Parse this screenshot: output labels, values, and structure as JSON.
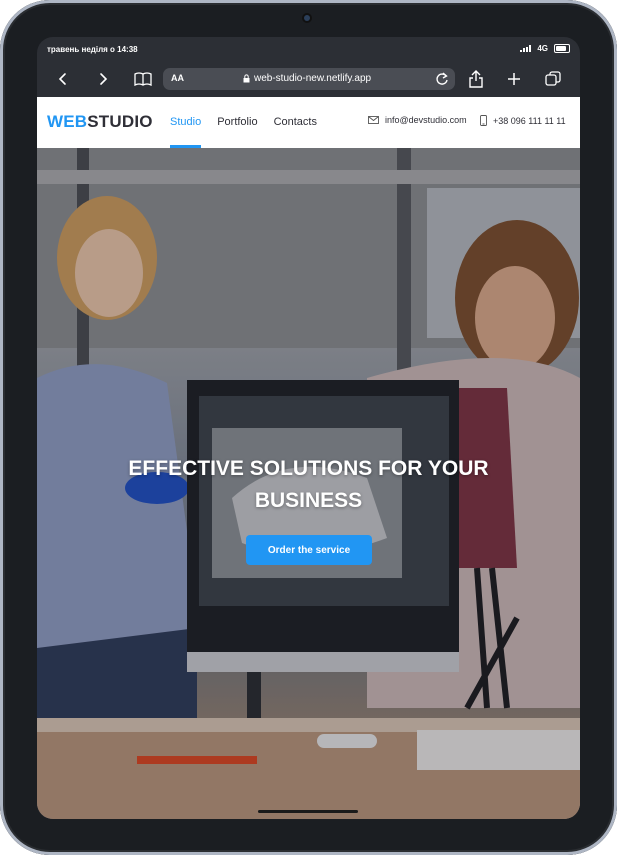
{
  "status_bar": {
    "time": "травень неділя о 14:38",
    "network": "4G"
  },
  "browser": {
    "text_size_label": "AA",
    "url": "web-studio-new.netlify.app",
    "icons": [
      "back-icon",
      "forward-icon",
      "bookmarks-icon",
      "lock-icon",
      "reload-icon",
      "share-icon",
      "new-tab-icon",
      "tabs-icon"
    ]
  },
  "site_header": {
    "logo_part1": "WEB",
    "logo_part2": "STUDIO",
    "nav": [
      {
        "label": "Studio",
        "active": true
      },
      {
        "label": "Portfolio",
        "active": false
      },
      {
        "label": "Contacts",
        "active": false
      }
    ],
    "email": "info@devstudio.com",
    "phone": "+38 096 111 11 11"
  },
  "hero": {
    "title": "EFFECTIVE SOLUTIONS FOR YOUR BUSINESS",
    "button": "Order the service"
  },
  "colors": {
    "accent": "#2196f3",
    "dark_text": "#2f2f37",
    "frame": "#1b1e22"
  }
}
